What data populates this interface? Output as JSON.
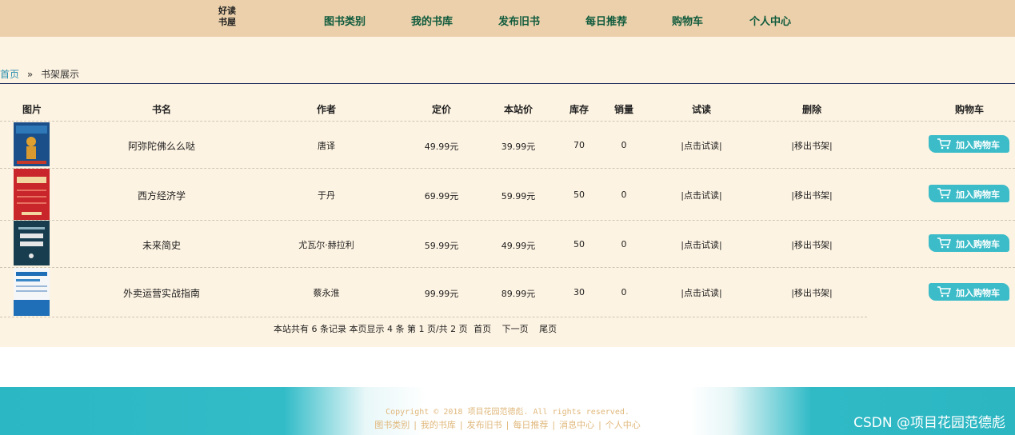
{
  "logo": {
    "line1": "好读",
    "line2": "书屋"
  },
  "nav": [
    "图书类别",
    "我的书库",
    "发布旧书",
    "每日推荐",
    "购物车",
    "个人中心"
  ],
  "breadcrumb": {
    "home": "首页",
    "sep": "»",
    "current": "书架展示"
  },
  "table": {
    "headers": [
      "图片",
      "书名",
      "作者",
      "定价",
      "本站价",
      "库存",
      "销量",
      "试读",
      "删除",
      "购物车"
    ],
    "rows": [
      {
        "title": "阿弥陀佛么么哒",
        "author": "唐译",
        "price": "49.99元",
        "site_price": "39.99元",
        "stock": "70",
        "sales": "0",
        "trial": "|点击试读|",
        "remove": "|移出书架|",
        "cart": "加入购物车"
      },
      {
        "title": "西方经济学",
        "author": "于丹",
        "price": "69.99元",
        "site_price": "59.99元",
        "stock": "50",
        "sales": "0",
        "trial": "|点击试读|",
        "remove": "|移出书架|",
        "cart": "加入购物车"
      },
      {
        "title": "未来简史",
        "author": "尤瓦尔·赫拉利",
        "price": "59.99元",
        "site_price": "49.99元",
        "stock": "50",
        "sales": "0",
        "trial": "|点击试读|",
        "remove": "|移出书架|",
        "cart": "加入购物车"
      },
      {
        "title": "外卖运营实战指南",
        "author": "蔡永淮",
        "price": "99.99元",
        "site_price": "89.99元",
        "stock": "30",
        "sales": "0",
        "trial": "|点击试读|",
        "remove": "|移出书架|",
        "cart": "加入购物车"
      }
    ],
    "covers": [
      {
        "icon": "book-cover-amituofo",
        "bg": "#1a4f8a",
        "accent": "#e0a030",
        "label": "阿弥陀佛么么哒"
      },
      {
        "icon": "book-cover-economics",
        "bg": "#c8262a",
        "accent": "#f2d6a0",
        "label": "西方经济学"
      },
      {
        "icon": "book-cover-future-history",
        "bg": "#173d4f",
        "accent": "#e6e6e6",
        "label": "未来简史"
      },
      {
        "icon": "book-cover-takeout-guide",
        "bg": "#f4f6f8",
        "accent": "#1f6fb8",
        "label": "外卖运营实战指南"
      }
    ]
  },
  "pager": {
    "summary": "本站共有 6 条记录 本页显示 4 条 第 1 页/共 2 页",
    "first": "首页",
    "next": "下一页",
    "last": "尾页"
  },
  "footer": {
    "copyright": "Copyright © 2018 项目花园范德彪. All rights reserved.",
    "links": [
      "图书类别",
      "我的书库",
      "发布旧书",
      "每日推荐",
      "消息中心",
      "个人中心"
    ]
  },
  "watermark": "CSDN @项目花园范德彪",
  "colors": {
    "header": "#ebd0ab",
    "content_bg": "#fdf3e2",
    "nav_text": "#0f5a3c",
    "cart_button": "#3bbcc8",
    "footer_teal": "#2bb7c4",
    "footer_text": "#e0b87c"
  }
}
